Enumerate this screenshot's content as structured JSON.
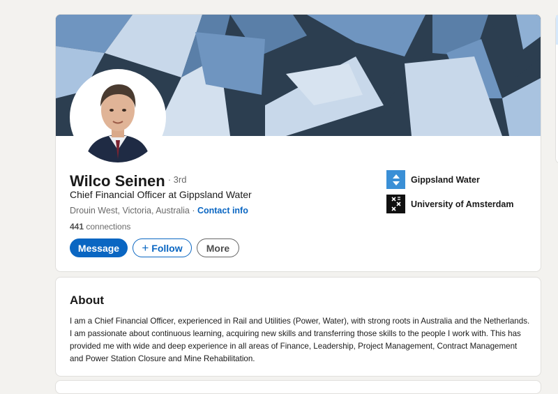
{
  "profile": {
    "name": "Wilco Seinen",
    "degree": "· 3rd",
    "headline": "Chief Financial Officer at Gippsland Water",
    "location": "Drouin West, Victoria, Australia",
    "separator": " · ",
    "contact_info_label": "Contact info",
    "connections_count": "441",
    "connections_label": " connections",
    "actions": {
      "message_label": "Message",
      "follow_icon": "plus-icon",
      "follow_label": "Follow",
      "more_label": "More"
    },
    "organizations": [
      {
        "name": "Gippsland Water",
        "logo": "gippsland-water-logo",
        "color": "#3a8fd6"
      },
      {
        "name": "University of Amsterdam",
        "logo": "university-of-amsterdam-logo",
        "color": "#111111"
      }
    ]
  },
  "about": {
    "title": "About",
    "text": "I am a Chief Financial Officer, experienced in Rail and Utilities (Power, Water), with strong roots in Australia and the Netherlands. I am passionate about continuous learning, acquiring new skills and transferring those skills to the people I work with. This has provided me with wide and deep experience in all areas of Finance, Leadership, Project Management, Contract Management and Power Station Closure and Mine Rehabilitation."
  },
  "colors": {
    "brand_blue": "#0a66c2",
    "page_background": "#f3f2ef",
    "banner_dark": "#2c3e50",
    "banner_mid": "#5a7fa8",
    "banner_light": "#c8d8ea"
  }
}
